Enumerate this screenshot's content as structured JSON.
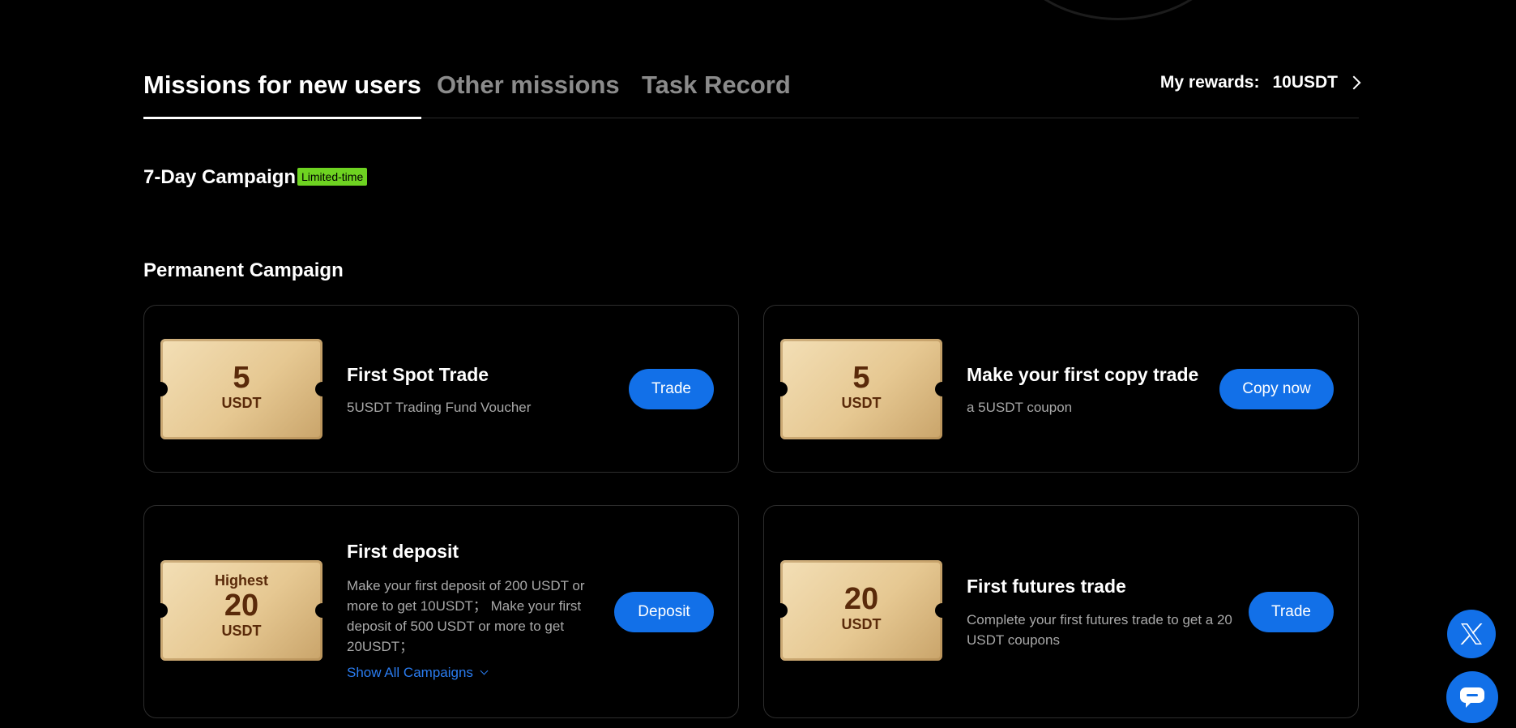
{
  "tabs": {
    "items": [
      {
        "label": "Missions for new users",
        "active": true
      },
      {
        "label": "Other missions",
        "active": false
      },
      {
        "label": "Task Record",
        "active": false
      }
    ],
    "rewards_label": "My rewards:",
    "rewards_value": "10USDT"
  },
  "campaign7": {
    "title": "7-Day Campaign",
    "badge": "Limited-time"
  },
  "permanent": {
    "title": "Permanent Campaign",
    "cards": [
      {
        "voucher_amount": "5",
        "voucher_unit": "USDT",
        "title": "First Spot Trade",
        "desc": "5USDT Trading Fund Voucher",
        "button": "Trade"
      },
      {
        "voucher_amount": "5",
        "voucher_unit": "USDT",
        "title": "Make your first copy trade",
        "desc": "a 5USDT coupon",
        "button": "Copy now"
      },
      {
        "voucher_top": "Highest",
        "voucher_amount": "20",
        "voucher_unit": "USDT",
        "title": "First deposit",
        "desc": "Make your first deposit of 200 USDT or more to get 10USDT；  Make your first deposit of 500 USDT or more to get 20USDT；",
        "link": "Show All Campaigns",
        "button": "Deposit"
      },
      {
        "voucher_amount": "20",
        "voucher_unit": "USDT",
        "title": "First futures trade",
        "desc": "Complete your first futures trade to get a 20 USDT coupons",
        "button": "Trade"
      }
    ]
  },
  "floating": {
    "icons": [
      "x-logo-icon",
      "chat-icon"
    ]
  },
  "colors": {
    "accent": "#1270e8",
    "badge": "#6ed321",
    "voucher_gold": "#e6c892",
    "voucher_text": "#5a2a0a"
  }
}
